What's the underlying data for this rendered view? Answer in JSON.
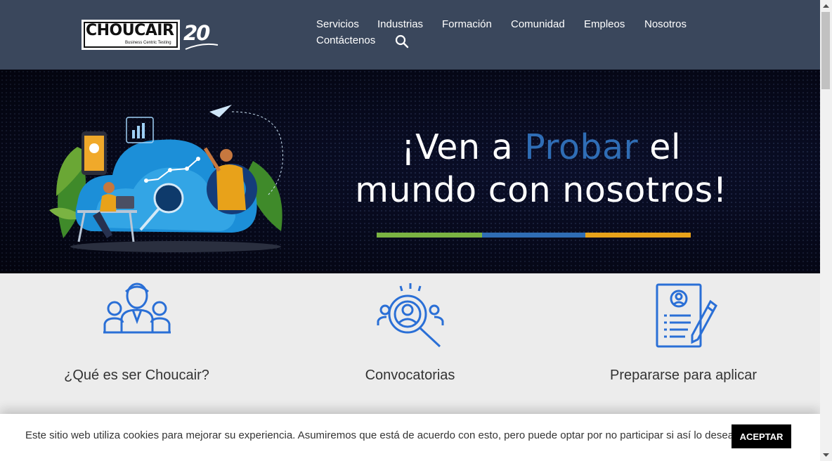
{
  "brand": {
    "name": "CHOUCAIR",
    "tagline": "Business Centric Testing",
    "anniversary": "20"
  },
  "nav": {
    "items": [
      "Servicios",
      "Industrias",
      "Formación",
      "Comunidad",
      "Empleos",
      "Nosotros",
      "Contáctenos"
    ],
    "search_icon": "search-icon"
  },
  "hero": {
    "line1_pre": "¡Ven a ",
    "line1_highlight": "Probar",
    "line1_post": " el",
    "line2": "mundo con nosotros!",
    "bar_colors": [
      "#7ab342",
      "#2f6db5",
      "#e8a21a"
    ]
  },
  "features": [
    {
      "label": "¿Qué es ser Choucair?",
      "icon": "team-icon"
    },
    {
      "label": "Convocatorias",
      "icon": "recruitment-search-icon"
    },
    {
      "label": "Prepararse para aplicar",
      "icon": "resume-pencil-icon"
    }
  ],
  "cookie": {
    "text": "Este sitio web utiliza cookies para mejorar su experiencia. Asumiremos que está de acuerdo con esto, pero puede optar por no participar si así lo desea.",
    "button": "ACEPTAR"
  },
  "colors": {
    "header_bg": "#3a475c",
    "accent_blue": "#2f6db5",
    "icon_blue": "#2a6fd6"
  }
}
